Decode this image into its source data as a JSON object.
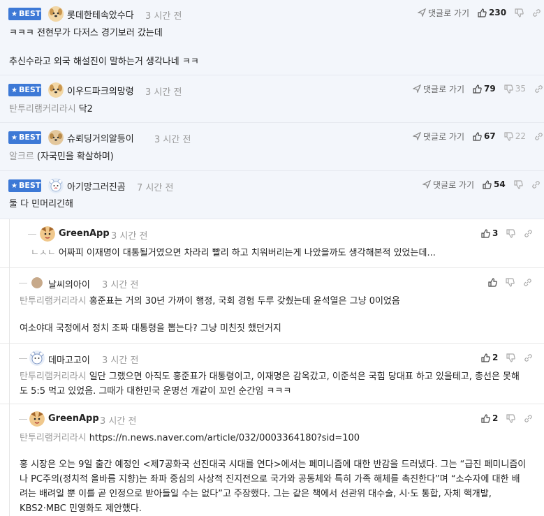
{
  "best_badge": "BEST",
  "reply_link": "댓글로 가기",
  "comments": [
    {
      "nick": "롯데한테속았수다",
      "time": "3 시간 전",
      "lines": [
        "ㅋㅋㅋ 전현무가 다저스 경기보러 갔는데",
        "추신수라고 외국 해설진이 말하는거 생각나네 ㅋㅋ"
      ],
      "up": "230",
      "down": ""
    },
    {
      "nick": "이우드파크의망령",
      "time": "3 시간 전",
      "ref": "탄투리램커리라시",
      "text": "닥2",
      "up": "79",
      "down": "35"
    },
    {
      "nick": "슈뢰딩거의알등이",
      "time": "3 시간 전",
      "ref": "알크르",
      "text": "(자국민을 확살하며)",
      "up": "67",
      "down": "22"
    },
    {
      "nick": "아기망그러진곰",
      "time": "7 시간 전",
      "text": "둘 다 민머리긴해",
      "up": "54",
      "down": ""
    }
  ],
  "replies": [
    {
      "nick": "GreenApp",
      "time": "3 시간 전",
      "mark": "ㄴㅅㄴ",
      "text": "어짜피 이재명이 대통될거였으면 차라리 빨리 하고 치워버리는게 나았을까도 생각해본적 있었는데...",
      "up": "3"
    },
    {
      "nick": "날씨의아이",
      "time": "3 시간 전",
      "ref": "탄투리램커리라시",
      "text": "홍준표는 거의 30년 가까이 행정, 국회 경험 두루 갖췄는데 윤석열은 그냥 0이었음",
      "text2": "여소야대 국정에서 정치 조짜 대통령을 뽑는다? 그냥 미친짓 했던거지",
      "up": ""
    },
    {
      "nick": "데마고고이",
      "time": "3 시간 전",
      "ref": "탄투리램커리라시",
      "text": "일단 그랬으면 아직도 홍준표가 대통령이고, 이재명은 감옥갔고, 이준석은 국힘 당대표 하고 있을테고, 총선은 못해",
      "text2": "도 5:5 먹고 있었음. 그때가 대한민국 운명선 개같이 꼬인 순간임 ㅋㅋㅋ",
      "up": "2"
    },
    {
      "nick": "GreenApp",
      "time": "3 시간 전",
      "ref": "탄투리램커리라시",
      "text": "https://n.news.naver.com/article/032/0003364180?sid=100",
      "paragraph": [
        "홍 시장은 오는 9일 출간 예정인 <제7공화국 선진대국 시대를 연다>에서는 페미니즘에 대한 반감을 드러냈다. 그는 “급진 페미니즘이",
        "나 PC주의(정치적 올바름 지향)는 좌파 중심의 사상적 진지전으로 국가와 공동체와 특히 가족 해체를 촉진한다”며 “소수자에 대한 배",
        "려는 배려일 뿐 이를 곧 인정으로 받아들일 수는 없다”고 주장했다. 그는 같은 책에서 선관위 대수술, 시·도 통합, 자체 핵개발,",
        "KBS2·MBC 민영화도 제안했다."
      ],
      "up": "2"
    }
  ]
}
